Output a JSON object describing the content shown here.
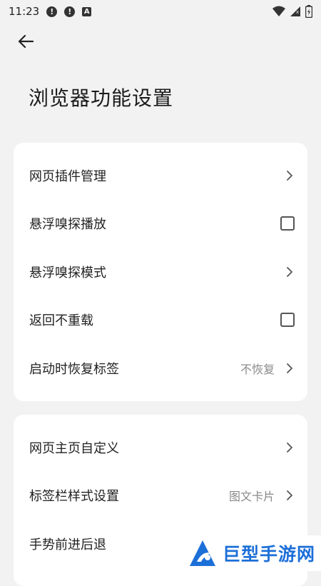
{
  "status_bar": {
    "time": "11:23",
    "notif_1": "!",
    "notif_2": "!",
    "notif_3": "A"
  },
  "header": {
    "back_icon": "arrow-left-icon",
    "title": "浏览器功能设置"
  },
  "card1": {
    "items": [
      {
        "label": "网页插件管理",
        "control": "chevron"
      },
      {
        "label": "悬浮嗅探播放",
        "control": "checkbox",
        "checked": false
      },
      {
        "label": "悬浮嗅探模式",
        "control": "chevron"
      },
      {
        "label": "返回不重载",
        "control": "checkbox",
        "checked": false
      },
      {
        "label": "启动时恢复标签",
        "value": "不恢复",
        "control": "chevron"
      }
    ]
  },
  "card2": {
    "items": [
      {
        "label": "网页主页自定义",
        "control": "chevron"
      },
      {
        "label": "标签栏样式设置",
        "value": "图文卡片",
        "control": "chevron"
      },
      {
        "label": "手势前进后退"
      }
    ]
  },
  "watermark": {
    "text": "巨型手游网"
  },
  "colors": {
    "background": "#f2f2f2",
    "card": "#ffffff",
    "watermark_blue": "#1d6fd8"
  }
}
